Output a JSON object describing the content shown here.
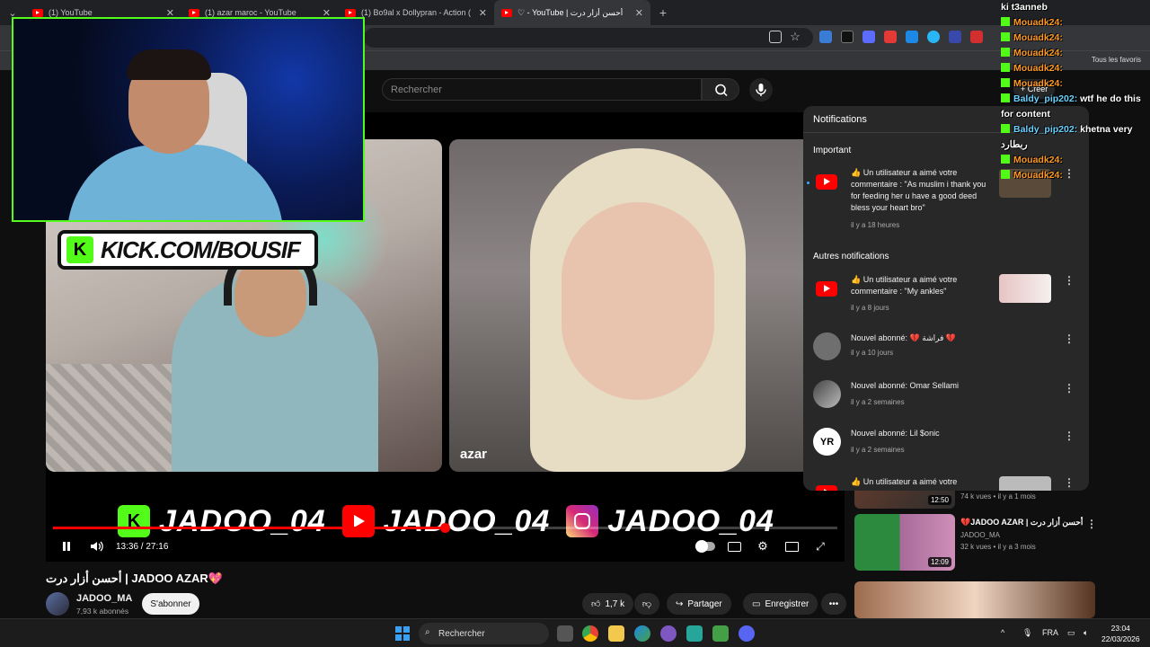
{
  "browser": {
    "tabs": [
      {
        "label": "(1) YouTube",
        "active": false
      },
      {
        "label": "(1) azar maroc - YouTube",
        "active": false
      },
      {
        "label": "(1) Bo9al x Dollypran - Action (",
        "active": false
      },
      {
        "label": "أحسن أزار درت | YouTube - ♡",
        "active": true
      }
    ],
    "bookmarks_all": "Tous les favoris"
  },
  "header": {
    "search_placeholder": "Rechercher",
    "create_label": "+ Créer"
  },
  "player": {
    "overlay_url": "KICK.COM/BOUSIF",
    "azar_logo": "azar",
    "handles": [
      "JADOO_04",
      "JADOO_04",
      "JADOO_04"
    ],
    "time_current": "13:36",
    "time_total": "27:16",
    "time_display": "13:36 / 27:16",
    "progress_fraction": 0.499
  },
  "video": {
    "title": "أحسن أزار درت | JADOO AZAR💖",
    "channel": "JADOO_MA",
    "subscribers": "7,93 k abonnés",
    "subscribe_label": "S'abonner",
    "likes": "1,7 k",
    "share_label": "Partager",
    "save_label": "Enregistrer",
    "more_label": "•••"
  },
  "recommendations": [
    {
      "title": "",
      "channel": "",
      "meta": "74 k vues • il y a 1 mois",
      "duration": "12:50"
    },
    {
      "title": "💔JADOO AZAR | أحسن أزار درت",
      "channel": "JADOO_MA",
      "meta": "32 k vues • il y a 3 mois",
      "duration": "12:09"
    },
    {
      "title": "",
      "channel": "",
      "meta": "",
      "duration": ""
    }
  ],
  "notifications": {
    "title": "Notifications",
    "important_label": "Important",
    "other_label": "Autres notifications",
    "items": [
      {
        "text": "👍 Un utilisateur a aimé votre commentaire : \"As muslim i thank you for feeding her u have a good deed bless your heart bro\"",
        "time": "il y a 18 heures"
      },
      {
        "text": "👍 Un utilisateur a aimé votre commentaire : \"My ankles\"",
        "time": "il y a 8 jours"
      },
      {
        "text": "Nouvel abonné: 💔 فراشة 💔",
        "time": "il y a 10 jours"
      },
      {
        "text": "Nouvel abonné: Omar Sellami",
        "time": "il y a 2 semaines"
      },
      {
        "text": "Nouvel abonné: Lil $onic",
        "time": "il y a 2 semaines"
      },
      {
        "text": "👍 Un utilisateur a aimé votre",
        "time": ""
      }
    ]
  },
  "chat": {
    "lines": [
      {
        "user": "",
        "message": "ki t3anneb"
      },
      {
        "user": "Mouadk24:",
        "message": ""
      },
      {
        "user": "Mouadk24:",
        "message": ""
      },
      {
        "user": "Mouadk24:",
        "message": ""
      },
      {
        "user": "Mouadk24:",
        "message": ""
      },
      {
        "user": "Mouadk24:",
        "message": ""
      },
      {
        "user": "Baldy_pip202:",
        "message": "wtf he do this"
      },
      {
        "user": "",
        "message": "for content"
      },
      {
        "user": "Baldy_pip202:",
        "message": "khetna very"
      },
      {
        "user": "",
        "message": "ربطارد"
      },
      {
        "user": "Mouadk24:",
        "message": ""
      },
      {
        "user": "Mouadk24:",
        "message": ""
      }
    ]
  },
  "taskbar": {
    "search_label": "Rechercher",
    "lang": "FRA",
    "time": "23:04",
    "date": "22/03/2026"
  },
  "colors": {
    "kick_green": "#53fc18",
    "youtube_red": "#ff0000",
    "chat_orange": "#ff9a1f",
    "chat_blue": "#6ad2ff"
  }
}
